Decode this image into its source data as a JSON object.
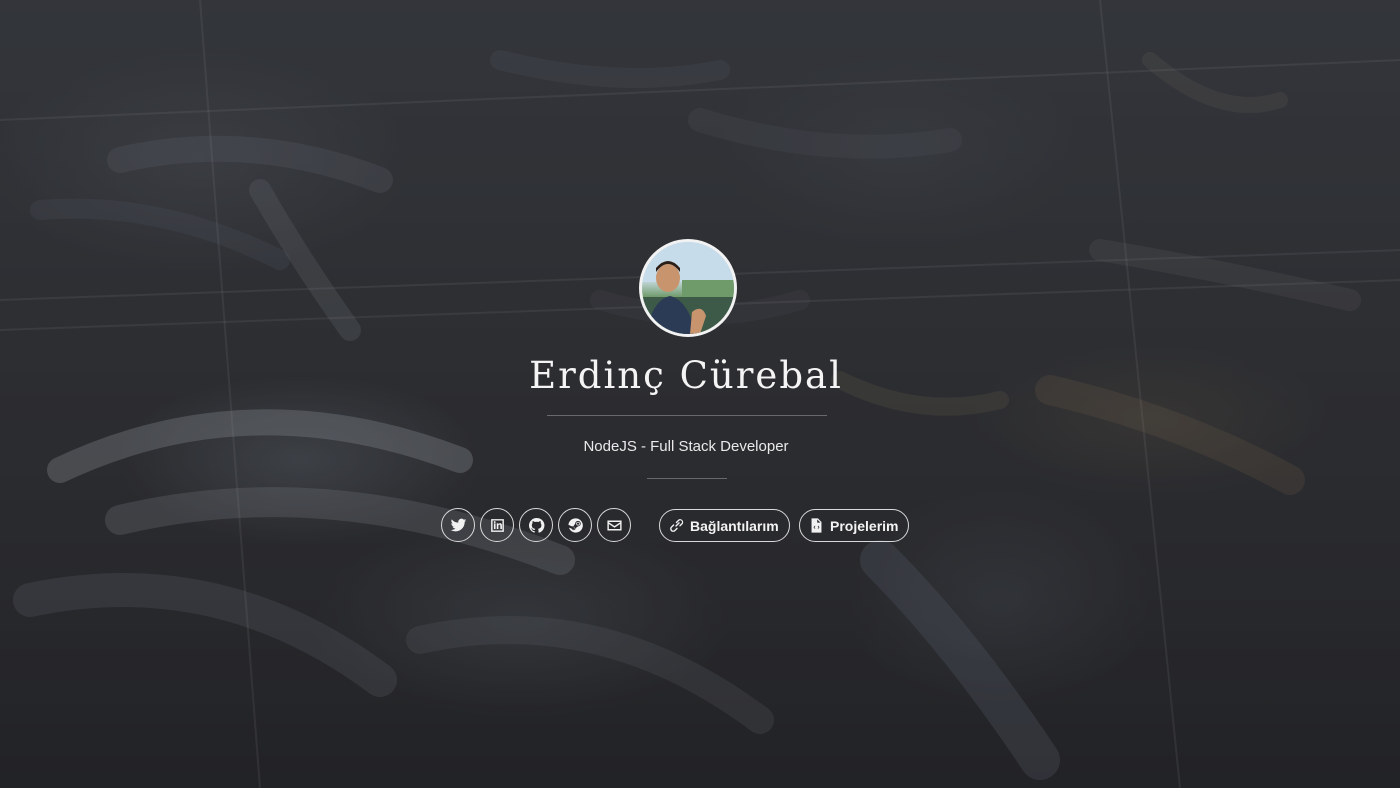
{
  "profile": {
    "name": "Erdinç Cürebal",
    "tagline": "NodeJS - Full Stack Developer",
    "avatar_icon": "avatar-photo"
  },
  "social": [
    {
      "name": "twitter",
      "icon": "twitter-icon"
    },
    {
      "name": "linkedin",
      "icon": "linkedin-icon"
    },
    {
      "name": "github",
      "icon": "github-icon"
    },
    {
      "name": "steam",
      "icon": "steam-icon"
    },
    {
      "name": "email",
      "icon": "envelope-icon"
    }
  ],
  "links": {
    "connections_label": "Bağlantılarım",
    "projects_label": "Projelerim"
  },
  "colors": {
    "text": "#f4f4f4",
    "border": "#d9d9d9",
    "background": "#36383c"
  }
}
